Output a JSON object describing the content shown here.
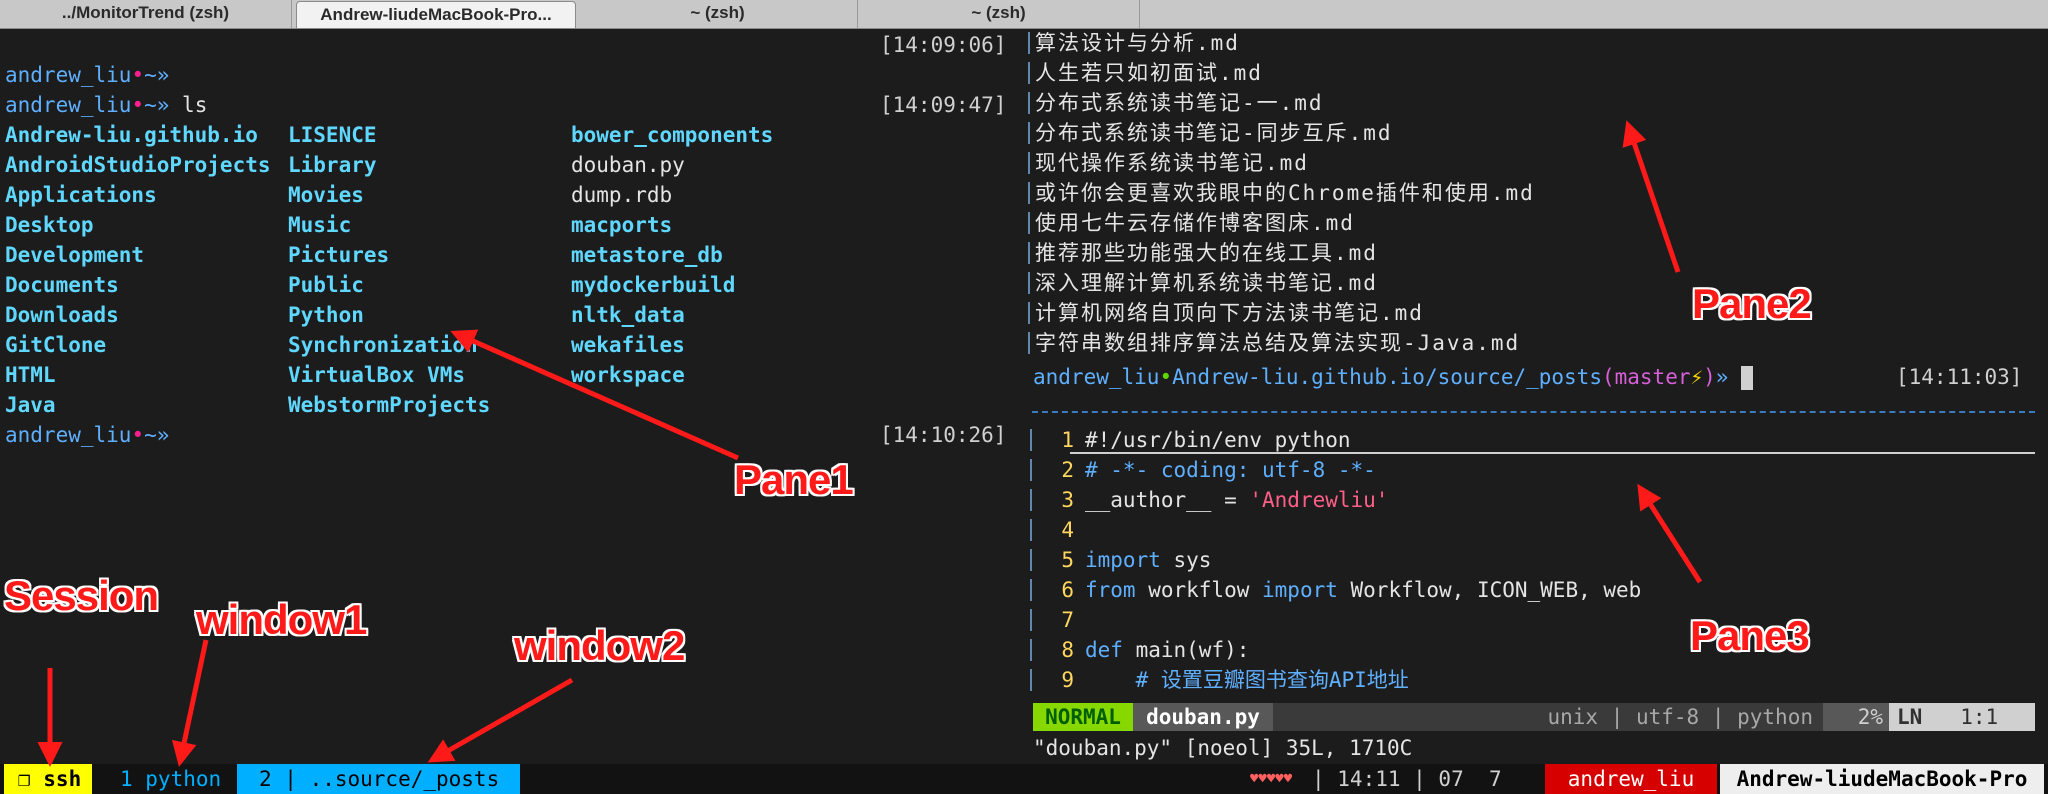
{
  "tabs": [
    "../MonitorTrend (zsh)",
    "Andrew-liudeMacBook-Pro...",
    "~ (zsh)",
    "~ (zsh)"
  ],
  "pane1": {
    "user": "andrew_liu",
    "dot": "•",
    "dir": "~»",
    "cmd": "ls",
    "timestamps": [
      "[14:09:06]",
      "[14:09:47]",
      "[14:10:26]"
    ],
    "col1": [
      "Andrew-liu.github.io",
      "AndroidStudioProjects",
      "Applications",
      "Desktop",
      "Development",
      "Documents",
      "Downloads",
      "GitClone",
      "HTML",
      "Java"
    ],
    "col2": [
      "LISENCE",
      "Library",
      "Movies",
      "Music",
      "Pictures",
      "Public",
      "Python",
      "Synchronization",
      "VirtualBox VMs",
      "WebstormProjects"
    ],
    "col3": [
      "bower_components",
      "douban.py",
      "dump.rdb",
      "macports",
      "metastore_db",
      "mydockerbuild",
      "nltk_data",
      "wekafiles",
      "workspace"
    ],
    "col3_is_dir": [
      true,
      false,
      false,
      true,
      true,
      true,
      true,
      true,
      true
    ]
  },
  "pane2": {
    "files": [
      "算法设计与分析.md",
      "人生若只如初面试.md",
      "分布式系统读书笔记-一.md",
      "分布式系统读书笔记-同步互斥.md",
      "现代操作系统读书笔记.md",
      "或许你会更喜欢我眼中的Chrome插件和使用.md",
      "使用七牛云存储作博客图床.md",
      "推荐那些功能强大的在线工具.md",
      "深入理解计算机系统读书笔记.md",
      "计算机网络自顶向下方法读书笔记.md",
      "字符串数组排序算法总结及算法实现-Java.md"
    ],
    "prompt_user": "andrew_liu",
    "prompt_dot": "•",
    "prompt_path": "Andrew-liu.github.io/source/_posts",
    "prompt_branch_open": "(",
    "prompt_branch": "master",
    "prompt_bolt": "⚡",
    "prompt_branch_close": ")",
    "prompt_arrow": "»",
    "timestamp": "[14:11:03]"
  },
  "pane3": {
    "line_numbers": [
      "1",
      "2",
      "3",
      "4",
      "5",
      "6",
      "7",
      "8",
      "9"
    ],
    "l1": "#!/usr/bin/env python",
    "l2": "# -*- coding: utf-8 -*-",
    "l3_a": "__author__ = ",
    "l3_b": "'Andrewliu'",
    "l5_kw": "import",
    "l5_rest": " sys",
    "l6_kw1": "from",
    "l6_mid": " workflow ",
    "l6_kw2": "import",
    "l6_rest": " Workflow, ICON_WEB, web",
    "l8_kw": "def",
    "l8_rest": " main(wf):",
    "l9_comment": "    # 设置豆瓣图书查询API地址",
    "status": {
      "mode": "NORMAL",
      "file": "douban.py",
      "info": "unix | utf-8 | python",
      "percent": "2%",
      "ln_label": "LN",
      "pos": "1:1"
    },
    "cmdline": "\"douban.py\" [noeol] 35L, 1710C"
  },
  "tmux": {
    "session": "❐ ssh",
    "window1": "1 python",
    "window2": "2 | ..source/_posts",
    "hearts": "♥♥♥♥♥",
    "time": "| 14:11 | 07  7",
    "user": "andrew_liu",
    "host": "Andrew-liudeMacBook-Pro"
  },
  "annotations": {
    "pane1": "Pane1",
    "pane2": "Pane2",
    "pane3": "Pane3",
    "session": "Session",
    "window1": "window1",
    "window2": "window2"
  },
  "colors": {
    "annotation": "#ff1a1a",
    "session_bg": "#ffff00",
    "window2_bg": "#00afff",
    "vim_mode_bg": "#87d700",
    "user_bg": "#d70000"
  }
}
